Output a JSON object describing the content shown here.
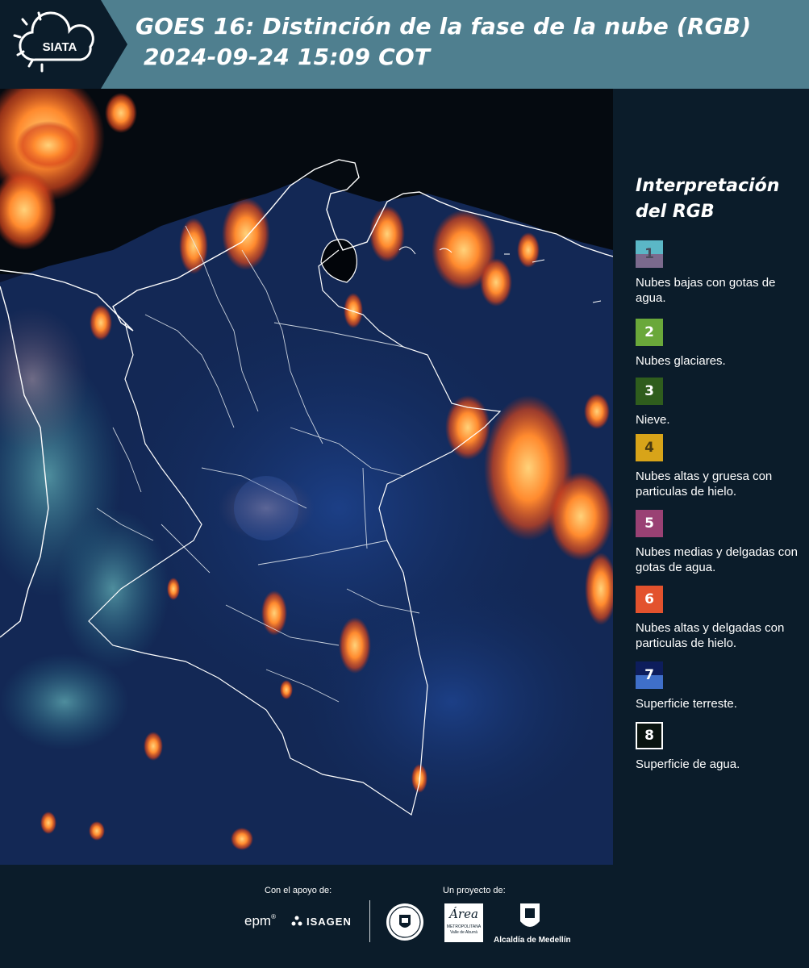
{
  "header": {
    "logo_text": "SIATA",
    "title_line1": "GOES 16: Distinción de la fase de la nube (RGB)",
    "title_line2": " 2024-09-24 15:09 COT",
    "bg_color": "#4f7f8f"
  },
  "legend": {
    "title_line1": "Interpretación",
    "title_line2": "del RGB",
    "items": [
      {
        "num": "1",
        "label": "Nubes bajas con gotas de agua.",
        "color_top": "#5bb7c6",
        "color_bottom": "#7b6a8d"
      },
      {
        "num": "2",
        "label": "Nubes glaciares.",
        "color": "#6aa83a"
      },
      {
        "num": "3",
        "label": "Nieve.",
        "color": "#2f5d1d"
      },
      {
        "num": "4",
        "label": "Nubes altas y gruesa con particulas de hielo.",
        "color": "#d8a419"
      },
      {
        "num": "5",
        "label": "Nubes medias y delgadas con gotas de agua.",
        "color": "#9a4174"
      },
      {
        "num": "6",
        "label": "Nubes altas y delgadas con particulas de hielo.",
        "color": "#e3522d"
      },
      {
        "num": "7",
        "label": "Superficie terreste.",
        "color_top": "#0d1d5c",
        "color_bottom": "#3f6fc9"
      },
      {
        "num": "8",
        "label": "Superficie de agua.",
        "color": "#0a1410"
      }
    ]
  },
  "footer": {
    "support_label": "Con el apoyo de:",
    "project_label": "Un proyecto de:",
    "sponsor1": "epm",
    "sponsor2": "ISAGEN",
    "partner_area_word": "Área",
    "partner_area_line1": "METROPOLITANA",
    "partner_area_line2": "Valle de Aburrá",
    "partner_alcaldia": "Alcaldía de Medellín"
  }
}
